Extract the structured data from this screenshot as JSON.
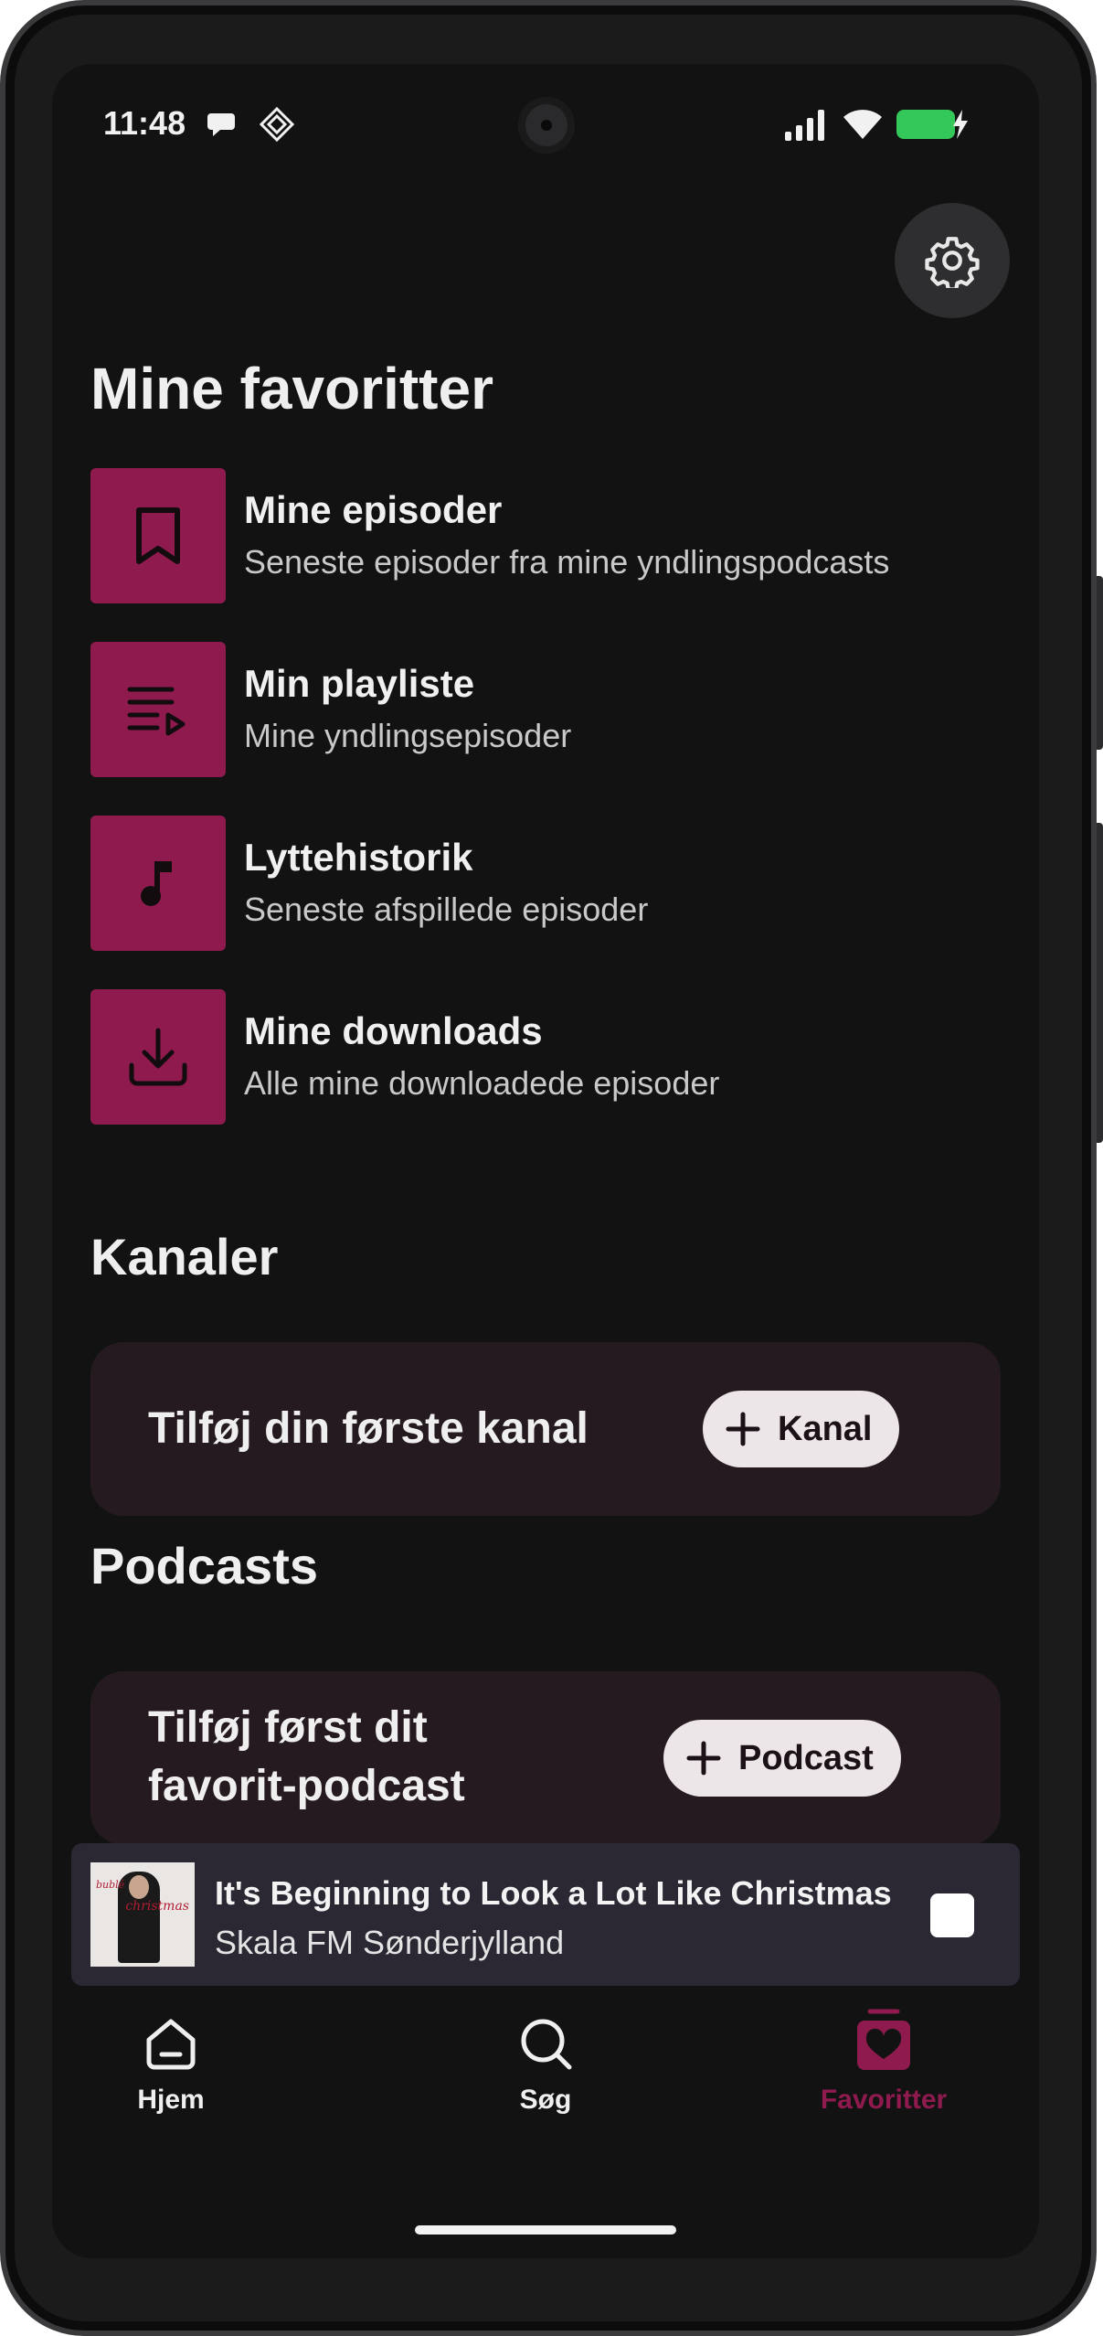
{
  "status_bar": {
    "time": "11:48"
  },
  "header": {
    "title": "Mine favoritter"
  },
  "favorites": [
    {
      "icon": "bookmark-icon",
      "title": "Mine episoder",
      "subtitle": "Seneste episoder fra mine yndlingspodcasts"
    },
    {
      "icon": "playlist-icon",
      "title": "Min playliste",
      "subtitle": "Mine yndlingsepisoder"
    },
    {
      "icon": "music-note-icon",
      "title": "Lyttehistorik",
      "subtitle": "Seneste afspillede episoder"
    },
    {
      "icon": "download-icon",
      "title": "Mine downloads",
      "subtitle": "Alle mine downloadede episoder"
    }
  ],
  "channels": {
    "heading": "Kanaler",
    "empty_text": "Tilføj din første kanal",
    "button_label": "Kanal"
  },
  "podcasts": {
    "heading": "Podcasts",
    "empty_text_line1": "Tilføj først dit",
    "empty_text_line2": "favorit-podcast",
    "button_label": "Podcast"
  },
  "mini_player": {
    "title": "It's Beginning to Look a Lot Like Christmas • I",
    "subtitle": "Skala FM Sønderjylland",
    "artwork_text": "christmas",
    "artwork_text_small": "bublé"
  },
  "bottom_nav": [
    {
      "label": "Hjem",
      "icon": "home-icon",
      "active": false
    },
    {
      "label": "Søg",
      "icon": "search-icon",
      "active": false
    },
    {
      "label": "Favoritter",
      "icon": "favorites-icon",
      "active": true
    }
  ],
  "colors": {
    "accent": "#8f1a4e",
    "background": "#121212",
    "card": "#261a21",
    "mini_player": "#2b2834"
  }
}
